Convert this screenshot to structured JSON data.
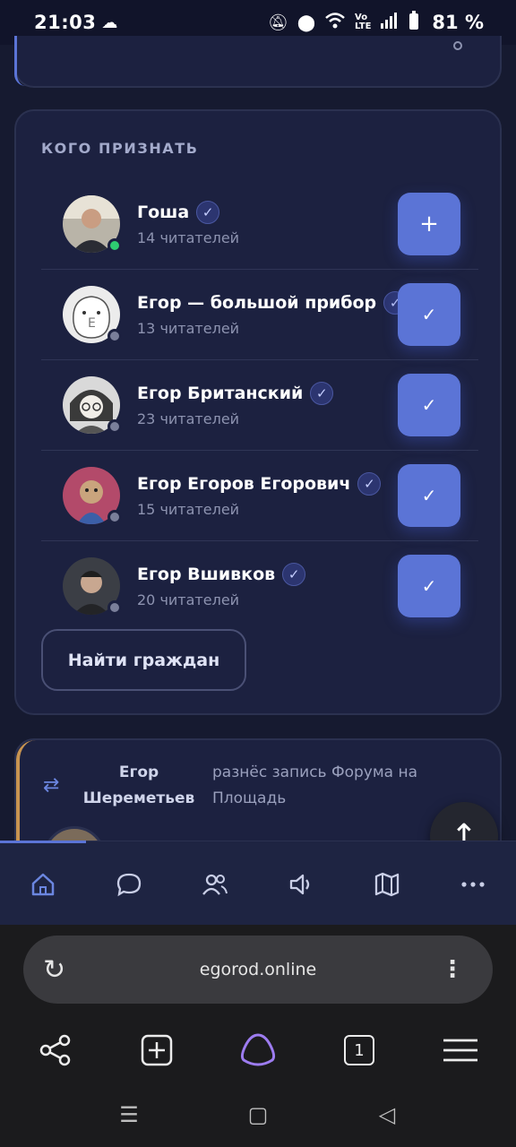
{
  "status_bar": {
    "time": "21:03",
    "battery": "81 %",
    "icons": [
      "cloud-icon",
      "mute-icon",
      "location-icon",
      "wifi-icon",
      "volte-icon",
      "signal-icon",
      "battery-icon"
    ]
  },
  "recommendations": {
    "title": "КОГО ПРИЗНАТЬ",
    "users": [
      {
        "name": "Гоша",
        "followers": "14 читателей",
        "verified": true,
        "online": true,
        "followed": false
      },
      {
        "name": "Егор — большой прибор",
        "followers": "13 читателей",
        "verified": true,
        "online": false,
        "followed": true
      },
      {
        "name": "Егор Британский",
        "followers": "23 читателей",
        "verified": true,
        "online": false,
        "followed": true
      },
      {
        "name": "Егор Егоров Егорович",
        "followers": "15 читателей",
        "verified": true,
        "online": false,
        "followed": true
      },
      {
        "name": "Егор Вшивков",
        "followers": "20 читателей",
        "verified": true,
        "online": false,
        "followed": true
      }
    ],
    "find_button": "Найти граждан"
  },
  "repost": {
    "user": "Егор Шереметьев",
    "text": "разнёс запись Форума на Площадь"
  },
  "bottom_nav": {
    "items": [
      "home-icon",
      "chat-icon",
      "people-icon",
      "speaker-icon",
      "map-icon",
      "more-icon"
    ],
    "active": "home-icon"
  },
  "browser": {
    "url": "egorod.online",
    "tab_count": "1"
  },
  "colors": {
    "accent": "#5b74d6",
    "background": "#161a30",
    "card": "#1c2140"
  }
}
